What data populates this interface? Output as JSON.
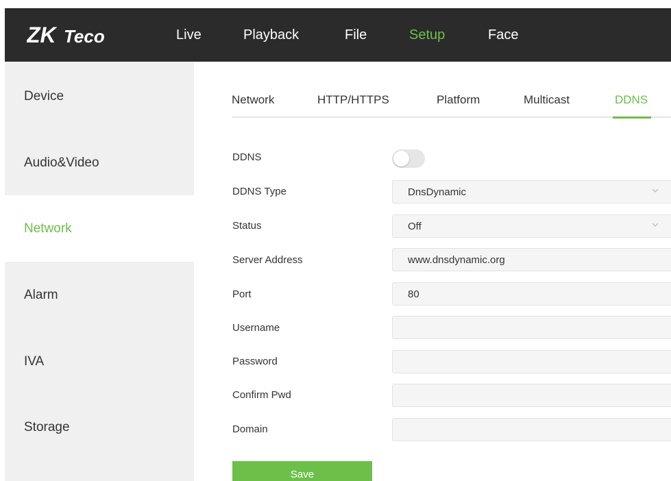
{
  "brand": {
    "logo_text_bold": "ZK",
    "logo_text_script": "Teco",
    "accent_color": "#6cc04a",
    "topbar_color": "#2b2b2b"
  },
  "nav": {
    "items": [
      {
        "label": "Live"
      },
      {
        "label": "Playback"
      },
      {
        "label": "File"
      },
      {
        "label": "Setup",
        "active": true
      },
      {
        "label": "Face"
      }
    ]
  },
  "sidebar": {
    "items": [
      {
        "label": "Device"
      },
      {
        "label": "Audio&Video"
      },
      {
        "label": "Network",
        "active": true
      },
      {
        "label": "Alarm"
      },
      {
        "label": "IVA"
      },
      {
        "label": "Storage"
      }
    ]
  },
  "tabs": {
    "items": [
      {
        "label": "Network"
      },
      {
        "label": "HTTP/HTTPS"
      },
      {
        "label": "Platform"
      },
      {
        "label": "Multicast"
      },
      {
        "label": "DDNS",
        "active": true
      }
    ]
  },
  "form": {
    "ddns": {
      "label": "DDNS",
      "enabled": false
    },
    "ddns_type": {
      "label": "DDNS Type",
      "value": "DnsDynamic"
    },
    "status": {
      "label": "Status",
      "value": "Off"
    },
    "server_address": {
      "label": "Server Address",
      "value": "www.dnsdynamic.org"
    },
    "port": {
      "label": "Port",
      "value": "80"
    },
    "username": {
      "label": "Username",
      "value": ""
    },
    "password": {
      "label": "Password",
      "value": ""
    },
    "confirm_pwd": {
      "label": "Confirm Pwd",
      "value": ""
    },
    "domain": {
      "label": "Domain",
      "value": ""
    },
    "save_label": "Save"
  }
}
